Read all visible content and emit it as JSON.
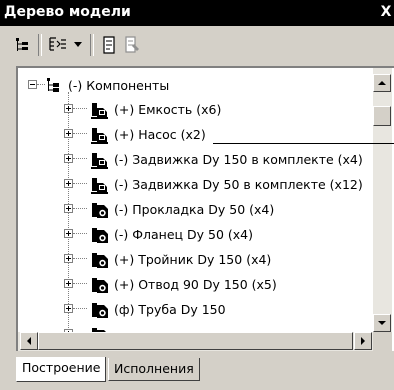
{
  "window": {
    "title": "Дерево модели",
    "close_glyph": "X"
  },
  "toolbar": {
    "buttons": [
      {
        "name": "tree-view-icon"
      },
      {
        "name": "display-mode-icon"
      },
      {
        "name": "dropdown-arrow-icon"
      },
      {
        "name": "document-icon"
      },
      {
        "name": "properties-icon"
      }
    ]
  },
  "tree": {
    "root": {
      "label": "(-) Компоненты",
      "expanded": true
    },
    "items": [
      {
        "label": "(+) Емкость (x6)",
        "icon": "assembly-icon"
      },
      {
        "label": "(+) Насос (x2)",
        "icon": "assembly-icon"
      },
      {
        "label": "(-) Задвижка Dy 150 в комплекте (x4)",
        "icon": "assembly-icon"
      },
      {
        "label": "(-) Задвижка Dy 50 в комплекте (x12)",
        "icon": "assembly-icon"
      },
      {
        "label": "(-) Прокладка Dy 50 (x4)",
        "icon": "part-icon"
      },
      {
        "label": "(-) Фланец Dy 50 (x4)",
        "icon": "part-icon"
      },
      {
        "label": "(+) Тройник Dy 150 (x4)",
        "icon": "part-icon"
      },
      {
        "label": "(+) Отвод 90 Dy 150 (x5)",
        "icon": "part-icon"
      },
      {
        "label": "(ф) Труба Dy 150",
        "icon": "part-icon"
      }
    ]
  },
  "tabs": [
    {
      "label": "Построение",
      "active": true
    },
    {
      "label": "Исполнения",
      "active": false
    }
  ]
}
